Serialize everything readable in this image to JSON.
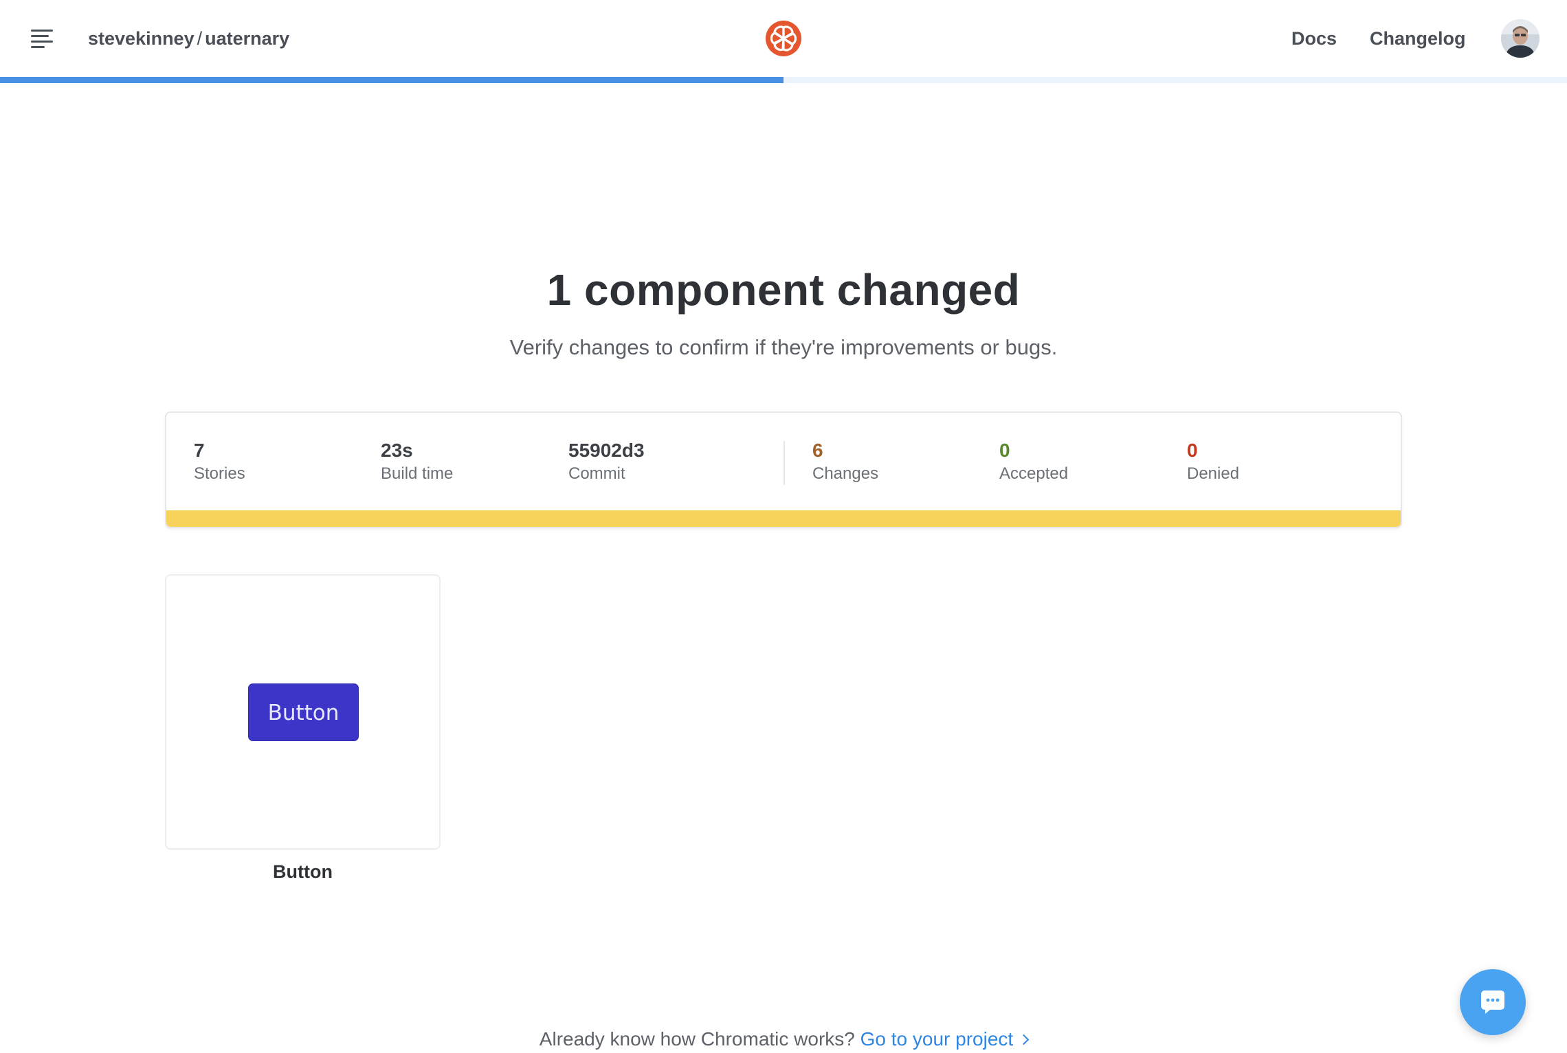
{
  "header": {
    "menu_icon": "hamburger-menu-icon",
    "owner": "stevekinney",
    "separator": "/",
    "project": "uaternary",
    "logo_icon": "chromatic-logo-icon",
    "brand_color": "#e4572e",
    "nav": {
      "docs": "Docs",
      "changelog": "Changelog"
    },
    "avatar_icon": "user-avatar",
    "progress_fraction": 0.5,
    "progress_color": "#4a90e2"
  },
  "hero": {
    "title": "1 component changed",
    "subtitle": "Verify changes to confirm if they're improvements or bugs."
  },
  "stats": {
    "stories": {
      "value": "7",
      "label": "Stories"
    },
    "build_time": {
      "value": "23s",
      "label": "Build time"
    },
    "commit": {
      "value": "55902d3",
      "label": "Commit"
    },
    "changes": {
      "value": "6",
      "label": "Changes",
      "color": "#a0612a"
    },
    "accepted": {
      "value": "0",
      "label": "Accepted",
      "color": "#5a8a2f"
    },
    "denied": {
      "value": "0",
      "label": "Denied",
      "color": "#c5391a"
    },
    "status_bar_color": "#f8d35c"
  },
  "components": [
    {
      "name": "Button",
      "preview_label": "Button",
      "preview_color": "#3d35c7"
    }
  ],
  "footer": {
    "prompt": "Already know how Chromatic works?",
    "link": "Go to your project",
    "link_icon": "chevron-right-icon"
  },
  "chat": {
    "icon": "chat-bubble-icon",
    "color": "#4aa3f0"
  }
}
